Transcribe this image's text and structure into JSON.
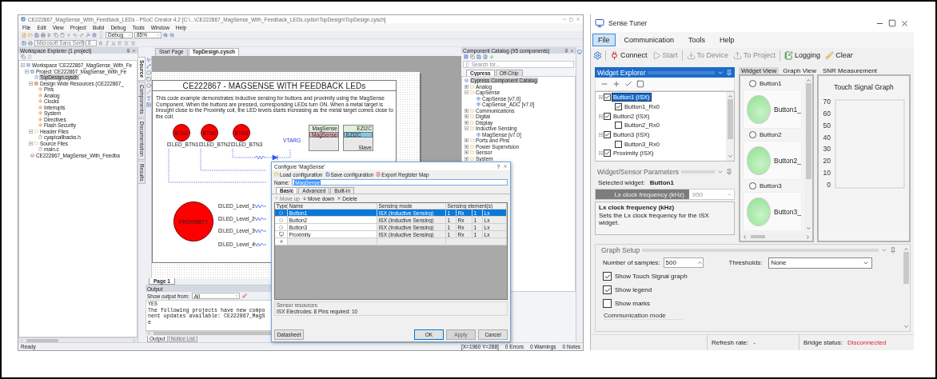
{
  "psoc": {
    "title": "CE222867_MagSense_With_Feedback_LEDs - PSoC Creator 4.2 [C:\\...\\CE222867_MagSense_With_Feedback_LEDs.cydsn\\TopDesign\\TopDesign.cysch]",
    "menu": [
      "File",
      "Edit",
      "View",
      "Project",
      "Build",
      "Debug",
      "Tools",
      "Window",
      "Help"
    ],
    "build_config": "Debug",
    "zoom": "85%",
    "font_family": "Microsoft Sans Serif",
    "font_size": "8",
    "workspace": {
      "title": "Workspace Explorer (1 project)",
      "tree": [
        {
          "label": "Workspace 'CE222867_MagSense_With_Fe",
          "kind": "workspace",
          "selected": false,
          "children": [
            {
              "label": "Project 'CE222867_MagSense_With_Fe",
              "kind": "project",
              "selected": false,
              "children": [
                {
                  "label": "TopDesign.cysch",
                  "kind": "schematic",
                  "selected": true
                },
                {
                  "label": "Design Wide Resources (CE222867_",
                  "kind": "resources",
                  "selected": false,
                  "children": [
                    {
                      "label": "Pins",
                      "kind": "resource",
                      "selected": false
                    },
                    {
                      "label": "Analog",
                      "kind": "resource",
                      "selected": false
                    },
                    {
                      "label": "Clocks",
                      "kind": "resource",
                      "selected": false
                    },
                    {
                      "label": "Interrupts",
                      "kind": "resource",
                      "selected": false
                    },
                    {
                      "label": "System",
                      "kind": "resource",
                      "selected": false
                    },
                    {
                      "label": "Directives",
                      "kind": "resource",
                      "selected": false
                    },
                    {
                      "label": "Flash Security",
                      "kind": "resource",
                      "selected": false
                    }
                  ]
                },
                {
                  "label": "Header Files",
                  "kind": "folder",
                  "selected": false,
                  "children": [
                    {
                      "label": "cyapicallbacks.h",
                      "kind": "file",
                      "selected": false
                    }
                  ]
                },
                {
                  "label": "Source Files",
                  "kind": "folder",
                  "selected": false,
                  "children": [
                    {
                      "label": "main.c",
                      "kind": "file",
                      "selected": false
                    }
                  ]
                }
              ]
            },
            {
              "label": "CE222867_MagSense_With_Feedba",
              "kind": "library",
              "selected": false
            }
          ]
        }
      ]
    },
    "side_tabs": [
      {
        "label": "Source",
        "selected": true
      },
      {
        "label": "Components",
        "selected": false
      },
      {
        "label": "Documentation",
        "selected": false
      },
      {
        "label": "Results",
        "selected": false
      }
    ],
    "doc_tabs": [
      {
        "label": "Start Page",
        "selected": false
      },
      {
        "label": "TopDesign.cysch",
        "selected": true
      }
    ],
    "schematic": {
      "title": "CE222867 - MAGSENSE WITH FEEDBACK LEDs",
      "description": "This code example demonstrates Inductive sensing for buttons and proximity using the MagSense Component. When the buttons are pressed, corresponding LEDs turn ON.  When a  metal target is brought close to the Proximity coil, the LED levels starts increasing as the metal target comes close to the coil.",
      "buttons": [
        "BTN1",
        "BTN2",
        "BTN3"
      ],
      "button_pins": [
        "LED_BTN1",
        "LED_BTN2",
        "LED_BTN3"
      ],
      "proximity": "PROXIMITY",
      "level_pins": [
        "LED_Level_1",
        "LED_Level_2",
        "LED_Level_3",
        "LED_Level_4"
      ],
      "supply": "VTARG",
      "components": [
        {
          "caption": "MagSense",
          "name": "MagSense",
          "color": "#f4b6c2"
        },
        {
          "caption": "EZI2C",
          "name": "EZI2C",
          "color": "#7fc8e6",
          "footer": "Slave"
        }
      ]
    },
    "page_tabs": [
      {
        "label": "Page 1",
        "selected": true
      }
    ],
    "output": {
      "title": "Output",
      "show_label": "Show output from:",
      "show_value": "All",
      "lines": [
        "YES",
        "The following projects have new component updates available: CE222867_MagSe"
      ],
      "tabs": [
        {
          "label": "Output",
          "selected": true
        },
        {
          "label": "Notice List",
          "selected": false
        }
      ]
    },
    "catalog": {
      "title": "Component Catalog (95 components)",
      "search_placeholder": "Search for...",
      "tabs": [
        {
          "label": "Cypress",
          "selected": true
        },
        {
          "label": "Off-Chip",
          "selected": false
        }
      ],
      "root": {
        "label": "Cypress Component Catalog",
        "selected": true
      },
      "tree": [
        {
          "label": "Analog",
          "expanded": false,
          "selected": false
        },
        {
          "label": "CapSense",
          "expanded": true,
          "selected": false,
          "children": [
            {
              "label": "CapSense [v7.0]",
              "selected": false
            },
            {
              "label": "CapSense_ADC [v7.0]",
              "selected": false
            }
          ]
        },
        {
          "label": "Communications",
          "expanded": false,
          "selected": false
        },
        {
          "label": "Digital",
          "expanded": false,
          "selected": false
        },
        {
          "label": "Display",
          "expanded": false,
          "selected": false
        },
        {
          "label": "Inductive Sensing",
          "expanded": true,
          "selected": false,
          "children": [
            {
              "label": "MagSense [v7.0]",
              "selected": false
            }
          ]
        },
        {
          "label": "Ports and Pins",
          "expanded": false,
          "selected": false
        },
        {
          "label": "Power Supervision",
          "expanded": false,
          "selected": false
        },
        {
          "label": "Sensor",
          "expanded": false,
          "selected": false
        },
        {
          "label": "System",
          "expanded": false,
          "selected": false
        }
      ]
    },
    "dialog": {
      "title": "Configure 'MagSense'",
      "help": "?",
      "toolbar": [
        "Load configuration",
        "Save configuration",
        "Export Register Map"
      ],
      "name_label": "Name:",
      "name_value": "MagSense",
      "tabs": [
        {
          "label": "Basic",
          "selected": true
        },
        {
          "label": "Advanced",
          "selected": false
        },
        {
          "label": "Built-in",
          "selected": false
        }
      ],
      "actions": [
        {
          "label": "Move up",
          "disabled": true
        },
        {
          "label": "Move down",
          "disabled": false
        },
        {
          "label": "Delete",
          "disabled": false
        }
      ],
      "columns": [
        "Type",
        "Name",
        "Sensing mode",
        "Sensing element(s)"
      ],
      "rows": [
        {
          "kind": "button",
          "name": "Button1",
          "mode": "ISX (Inductive Sensing)",
          "elements": [
            "1",
            "Rx",
            "1",
            "Lx"
          ],
          "selected": true
        },
        {
          "kind": "button",
          "name": "Button2",
          "mode": "ISX (Inductive Sensing)",
          "elements": [
            "1",
            "Rx",
            "1",
            "Lx"
          ],
          "selected": false
        },
        {
          "kind": "button",
          "name": "Button3",
          "mode": "ISX (Inductive Sensing)",
          "elements": [
            "1",
            "Rx",
            "1",
            "Lx"
          ],
          "selected": false
        },
        {
          "kind": "proximity",
          "name": "Proximity",
          "mode": "ISX (Inductive Sensing)",
          "elements": [
            "1",
            "Rx",
            "1",
            "Lx"
          ],
          "selected": false
        }
      ],
      "resources_title": "Sensor resources",
      "resources": "ISX Electrodes: 8  Pins required: 10",
      "buttons": [
        {
          "label": "Datasheet",
          "disabled": false
        },
        {
          "label": "OK",
          "disabled": false
        },
        {
          "label": "Apply",
          "disabled": true
        },
        {
          "label": "Cancel",
          "disabled": false
        }
      ]
    },
    "status_bar": {
      "message": "Ready",
      "position": "[X=1960 Y=288]",
      "errors": "0 Errors",
      "warnings": "0 Warnings",
      "notes": "0 Notes"
    }
  },
  "tuner": {
    "title": "Sense Tuner",
    "menu": [
      {
        "label": "File",
        "selected": true
      },
      {
        "label": "Communication",
        "selected": false
      },
      {
        "label": "Tools",
        "selected": false
      },
      {
        "label": "Help",
        "selected": false
      }
    ],
    "toolbar": [
      {
        "kind": "connect",
        "label": "Connect",
        "disabled": false
      },
      {
        "kind": "start",
        "label": "Start",
        "disabled": true
      },
      {
        "kind": "to_device",
        "label": "To Device",
        "disabled": true
      },
      {
        "kind": "to_project",
        "label": "To Project",
        "disabled": true
      },
      {
        "kind": "logging",
        "label": "Logging",
        "disabled": false
      },
      {
        "kind": "clear",
        "label": "Clear",
        "disabled": false
      }
    ],
    "explorer": {
      "title": "Widget Explorer",
      "tree": [
        {
          "label": "Button1 (ISX)",
          "checked": true,
          "selected": true,
          "children": [
            {
              "label": "Button1_Rx0",
              "checked": true,
              "selected": false
            }
          ]
        },
        {
          "label": "Button2 (ISX)",
          "checked": true,
          "selected": false,
          "children": [
            {
              "label": "Button2_Rx0",
              "checked": false,
              "selected": false
            }
          ]
        },
        {
          "label": "Button3 (ISX)",
          "checked": true,
          "selected": false,
          "children": [
            {
              "label": "Button3_Rx0",
              "checked": false,
              "selected": false
            }
          ]
        },
        {
          "label": "Proximity (ISX)",
          "checked": true,
          "selected": false
        }
      ]
    },
    "params": {
      "title": "Widget/Sensor Parameters",
      "selected_label": "Selected widget:",
      "selected_value": "Button1",
      "field_label": "Lx clock frequency (kHz)",
      "field_value": "950",
      "help_title": "Lx clock frequency (kHz)",
      "help_text": "Sets the Lx clock frequency for the ISX widget."
    },
    "view_tabs": [
      {
        "label": "Widget View",
        "selected": true
      },
      {
        "label": "Graph View",
        "selected": false
      },
      {
        "label": "SNR Measurement",
        "selected": false
      }
    ],
    "widgets": [
      {
        "name": "Button1",
        "sensor": "Button1_",
        "selected": false
      },
      {
        "name": "Button2",
        "sensor": "Button2_",
        "selected": false
      },
      {
        "name": "Button3",
        "sensor": "Button3_",
        "selected": false
      }
    ],
    "graph": {
      "title": "Touch Signal Graph",
      "y_labels": [
        "70",
        "60",
        "50",
        "40",
        "30",
        "20",
        "10",
        "0"
      ]
    },
    "setup": {
      "title": "Graph Setup",
      "samples_label": "Number of samples:",
      "samples": "500",
      "thresholds_label": "Thresholds:",
      "thresholds": "None",
      "options": [
        {
          "label": "Show Touch Signal graph",
          "checked": true
        },
        {
          "label": "Show legend",
          "checked": true
        },
        {
          "label": "Show marks",
          "checked": false
        }
      ],
      "group": "Communication mode"
    },
    "status": {
      "refresh_label": "Refresh rate:",
      "refresh": "-",
      "bridge_label": "Bridge status:",
      "bridge": "Disconnected"
    }
  }
}
